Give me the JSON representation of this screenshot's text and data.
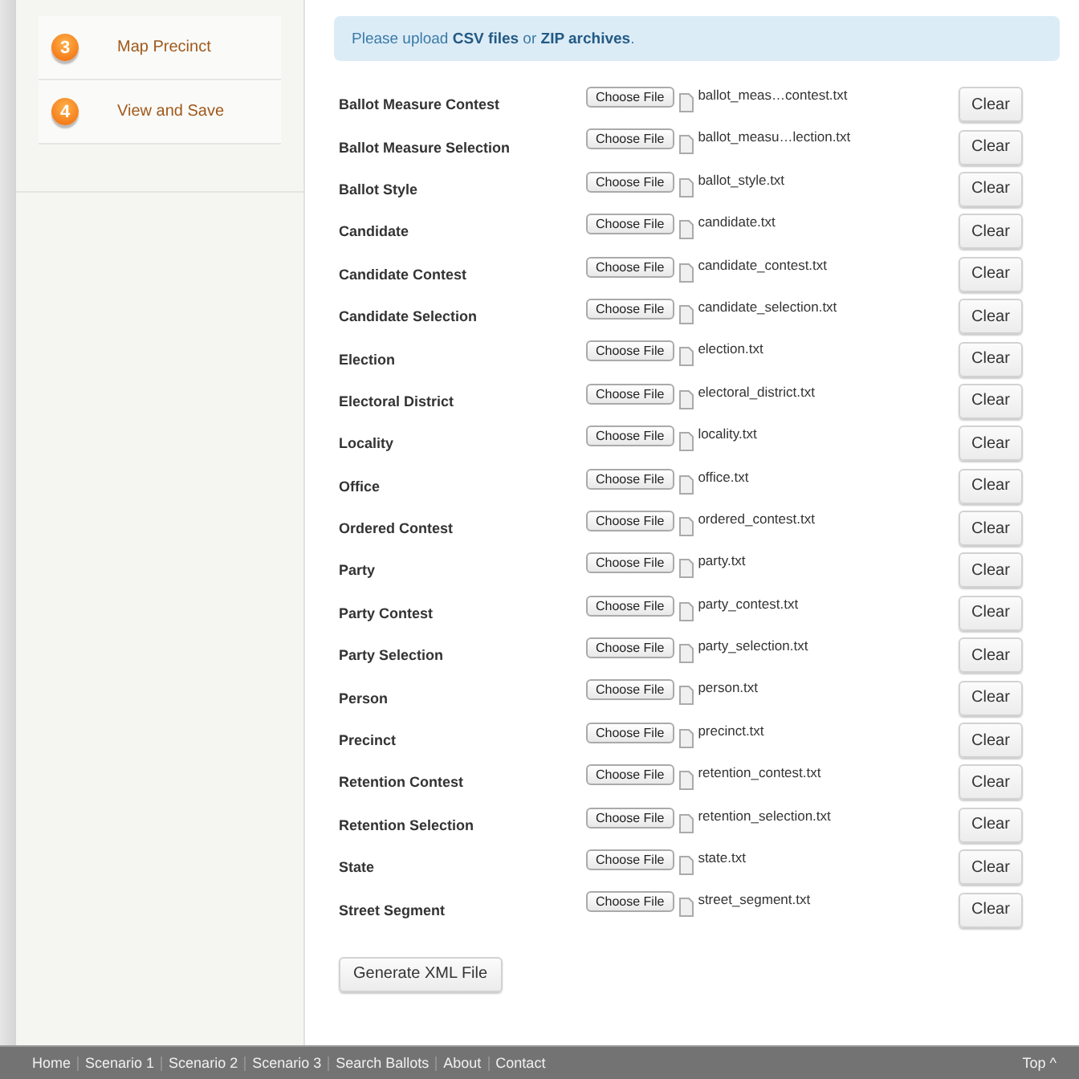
{
  "sidebar": {
    "steps": [
      {
        "number": "3",
        "label": "Map Precinct"
      },
      {
        "number": "4",
        "label": "View and Save"
      }
    ]
  },
  "notice": "Please upload **CSV files** or **ZIP archives**.",
  "uploads": [
    {
      "label": "Ballot Measure Contest",
      "choose": "Choose File",
      "file": "ballot_meas…contest.txt",
      "clear": "Clear"
    },
    {
      "label": "Ballot Measure Selection",
      "choose": "Choose File",
      "file": "ballot_measu…lection.txt",
      "clear": "Clear"
    },
    {
      "label": "Ballot Style",
      "choose": "Choose File",
      "file": "ballot_style.txt",
      "clear": "Clear"
    },
    {
      "label": "Candidate",
      "choose": "Choose File",
      "file": "candidate.txt",
      "clear": "Clear"
    },
    {
      "label": "Candidate Contest",
      "choose": "Choose File",
      "file": "candidate_contest.txt",
      "clear": "Clear"
    },
    {
      "label": "Candidate Selection",
      "choose": "Choose File",
      "file": "candidate_selection.txt",
      "clear": "Clear"
    },
    {
      "label": "Election",
      "choose": "Choose File",
      "file": "election.txt",
      "clear": "Clear"
    },
    {
      "label": "Electoral District",
      "choose": "Choose File",
      "file": "electoral_district.txt",
      "clear": "Clear"
    },
    {
      "label": "Locality",
      "choose": "Choose File",
      "file": "locality.txt",
      "clear": "Clear"
    },
    {
      "label": "Office",
      "choose": "Choose File",
      "file": "office.txt",
      "clear": "Clear"
    },
    {
      "label": "Ordered Contest",
      "choose": "Choose File",
      "file": "ordered_contest.txt",
      "clear": "Clear"
    },
    {
      "label": "Party",
      "choose": "Choose File",
      "file": "party.txt",
      "clear": "Clear"
    },
    {
      "label": "Party Contest",
      "choose": "Choose File",
      "file": "party_contest.txt",
      "clear": "Clear"
    },
    {
      "label": "Party Selection",
      "choose": "Choose File",
      "file": "party_selection.txt",
      "clear": "Clear"
    },
    {
      "label": "Person",
      "choose": "Choose File",
      "file": "person.txt",
      "clear": "Clear"
    },
    {
      "label": "Precinct",
      "choose": "Choose File",
      "file": "precinct.txt",
      "clear": "Clear"
    },
    {
      "label": "Retention Contest",
      "choose": "Choose File",
      "file": "retention_contest.txt",
      "clear": "Clear"
    },
    {
      "label": "Retention Selection",
      "choose": "Choose File",
      "file": "retention_selection.txt",
      "clear": "Clear"
    },
    {
      "label": "State",
      "choose": "Choose File",
      "file": "state.txt",
      "clear": "Clear"
    },
    {
      "label": "Street Segment",
      "choose": "Choose File",
      "file": "street_segment.txt",
      "clear": "Clear"
    }
  ],
  "generate_button": "Generate XML File",
  "footer": {
    "links": [
      "Home",
      "Scenario 1",
      "Scenario 2",
      "Scenario 3",
      "Search Ballots",
      "About",
      "Contact"
    ],
    "top_link": "Top ^"
  }
}
